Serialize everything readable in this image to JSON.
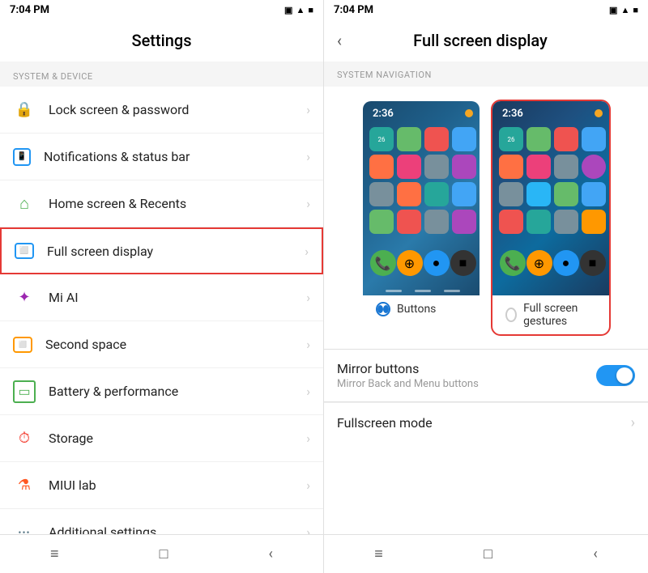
{
  "left": {
    "statusBar": {
      "time": "7:04 PM",
      "icons": "▣ ▲ ■"
    },
    "title": "Settings",
    "sectionHeader": "SYSTEM & DEVICE",
    "items": [
      {
        "id": "lock-screen",
        "icon": "🔒",
        "label": "Lock screen & password",
        "iconClass": "icon-lock",
        "highlighted": false
      },
      {
        "id": "notifications",
        "icon": "📱",
        "label": "Notifications & status bar",
        "iconClass": "icon-notif",
        "highlighted": false
      },
      {
        "id": "home-screen",
        "icon": "⌂",
        "label": "Home screen & Recents",
        "iconClass": "icon-home",
        "highlighted": false
      },
      {
        "id": "fullscreen",
        "icon": "⬜",
        "label": "Full screen display",
        "iconClass": "icon-fullscreen",
        "highlighted": true
      },
      {
        "id": "mi-ai",
        "icon": "✦",
        "label": "Mi AI",
        "iconClass": "icon-miai",
        "highlighted": false
      },
      {
        "id": "second-space",
        "icon": "◈",
        "label": "Second space",
        "iconClass": "icon-space",
        "highlighted": false
      },
      {
        "id": "battery",
        "icon": "▭",
        "label": "Battery & performance",
        "iconClass": "icon-battery",
        "highlighted": false
      },
      {
        "id": "storage",
        "icon": "⏱",
        "label": "Storage",
        "iconClass": "icon-storage",
        "highlighted": false
      },
      {
        "id": "miui-lab",
        "icon": "⚗",
        "label": "MIUI lab",
        "iconClass": "icon-miui",
        "highlighted": false
      },
      {
        "id": "additional",
        "icon": "···",
        "label": "Additional settings",
        "iconClass": "icon-more",
        "highlighted": false
      }
    ],
    "navBar": {
      "menu": "≡",
      "home": "□",
      "back": "‹"
    }
  },
  "right": {
    "statusBar": {
      "time": "7:04 PM",
      "icons": "▣ ▲ ■"
    },
    "title": "Full  screen  display",
    "sectionHeader": "SYSTEM NAVIGATION",
    "options": [
      {
        "id": "buttons",
        "label": "Buttons",
        "selected": true
      },
      {
        "id": "fullscreen-gestures",
        "label": "Full screen gestures",
        "selected": false
      }
    ],
    "mirrorButtons": {
      "title": "Mirror buttons",
      "subtitle": "Mirror Back and Menu buttons",
      "enabled": true
    },
    "fullscreenMode": {
      "title": "Fullscreen mode"
    },
    "navBar": {
      "menu": "≡",
      "home": "□",
      "back": "‹"
    }
  }
}
